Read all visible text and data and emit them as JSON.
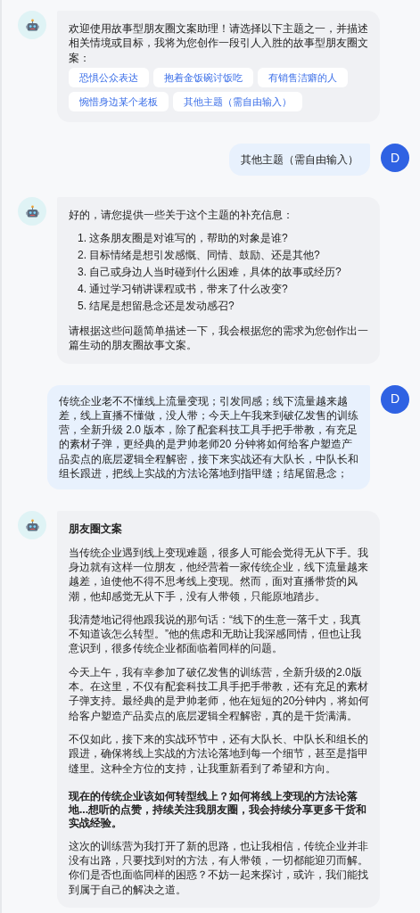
{
  "messages": [
    {
      "kind": "bot",
      "blocks": [
        {
          "kind": "paragraph",
          "text": "欢迎使用故事型朋友圈文案助理！请选择以下主题之一，并描述相关情境或目标，我将为您创作一段引人入胜的故事型朋友圈文案："
        },
        {
          "kind": "options",
          "items": [
            "恐惧公众表达",
            "抱着金饭碗讨饭吃",
            "有销售洁癖的人",
            "惋惜身边某个老板",
            "其他主题（需自由输入）"
          ]
        }
      ]
    },
    {
      "kind": "user",
      "avatar": "D",
      "text": "其他主题（需自由输入）"
    },
    {
      "kind": "bot",
      "blocks": [
        {
          "kind": "paragraph",
          "text": "好的，请您提供一些关于这个主题的补充信息："
        },
        {
          "kind": "list",
          "items": [
            {
              "number": "1.",
              "text": "这条朋友圈是对谁写的，帮助的对象是谁?"
            },
            {
              "number": "2.",
              "text": "目标情绪是想引发感慨、同情、鼓励、还是其他?"
            },
            {
              "number": "3.",
              "text": "自己或身边人当时碰到什么困难，具体的故事或经历?"
            },
            {
              "number": "4.",
              "text": "通过学习销讲课程或书，带来了什么改变?"
            },
            {
              "number": "5.",
              "text": "结尾是想留悬念还是发动感召?"
            }
          ]
        },
        {
          "kind": "paragraph",
          "text": "请根据这些问题简单描述一下，我会根据您的需求为您创作出一篇生动的朋友圈故事文案。"
        }
      ]
    },
    {
      "kind": "user",
      "avatar": "D",
      "text": "传统企业老不不懂线上流量变现；引发同感；线下流量越来越差，线上直播不懂做，没人带；今天上午我来到破亿发售的训练营，全新升级 2.0 版本，除了配套科技工具手把手带教，有充足的素材子弹，更经典的是尹帅老师20 分钟将如何给客户塑造产品卖点的底层逻辑全程解密，接下来实战还有大队长，中队长和组长跟进，把线上实战的方法论落地到指甲缝；结尾留悬念；"
    },
    {
      "kind": "bot",
      "blocks": [
        {
          "kind": "heading",
          "text": "朋友圈文案"
        },
        {
          "kind": "paragraph",
          "text": "当传统企业遇到线上变现难题，很多人可能会觉得无从下手。我身边就有这样一位朋友，他经营着一家传统企业，线下流量越来越差，迫使他不得不思考线上变现。然而，面对直播带货的风潮，他却感觉无从下手，没有人带领，只能原地踏步。"
        },
        {
          "kind": "paragraph",
          "text": "我清楚地记得他跟我说的那句话：“线下的生意一落千丈，我真不知道该怎么转型。”他的焦虑和无助让我深感同情，但也让我意识到，很多传统企业都面临着同样的问题。"
        },
        {
          "kind": "paragraph",
          "text": "今天上午，我有幸参加了破亿发售的训练营，全新升级的2.0版本。在这里，不仅有配套科技工具手把手带教，还有充足的素材子弹支持。最经典的是尹帅老师，他在短短的20分钟内，将如何给客户塑造产品卖点的底层逻辑全程解密，真的是干货满满。"
        },
        {
          "kind": "paragraph",
          "text": "不仅如此，接下来的实战环节中，还有大队长、中队长和组长的跟进，确保将线上实战的方法论落地到每一个细节，甚至是指甲缝里。这种全方位的支持，让我重新看到了希望和方向。"
        },
        {
          "kind": "bold_paragraph",
          "text": "现在的传统企业该如何转型线上？如何将线上变现的方法论落地...想听的点赞，持续关注我朋友圈，我会持续分享更多干货和实战经验。"
        },
        {
          "kind": "paragraph",
          "text": "这次的训练营为我打开了新的思路，也让我相信，传统企业并非没有出路，只要找到对的方法，有人带领，一切都能迎刃而解。你们是否也面临同样的困惑？不妨一起来探讨，或许，我们能找到属于自己的解决之道。"
        }
      ]
    }
  ]
}
